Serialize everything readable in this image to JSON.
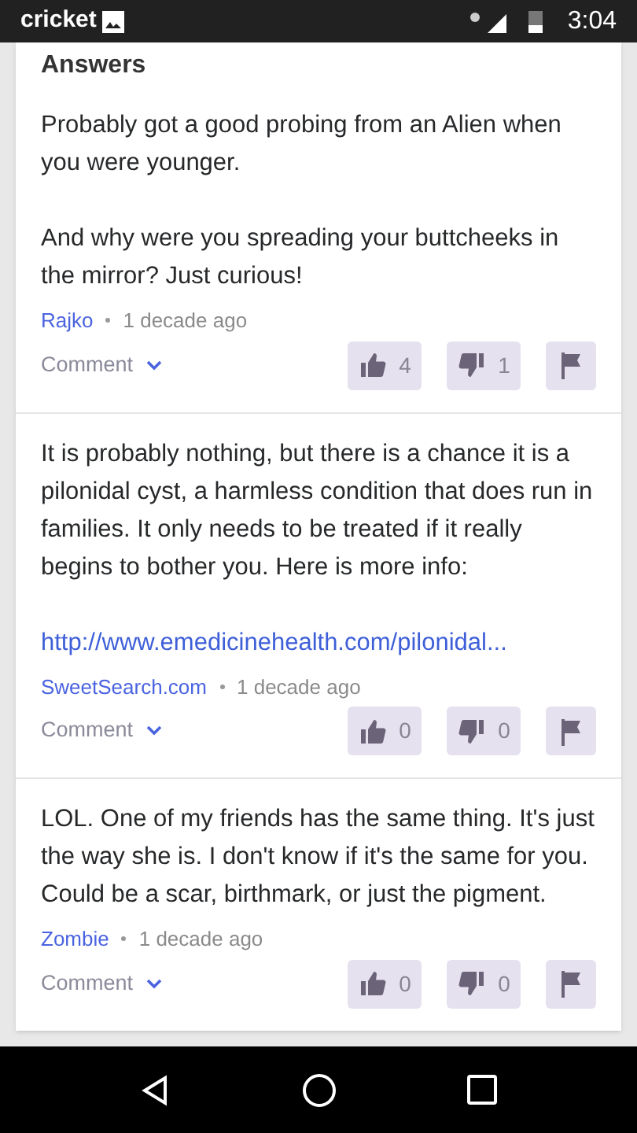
{
  "status_bar": {
    "carrier": "cricket",
    "time": "3:04"
  },
  "section_title": "Answers",
  "answers": [
    {
      "paragraphs": [
        "Probably got a good probing from an Alien when you were younger.",
        "And why were you spreading your buttcheeks in the mirror? Just curious!"
      ],
      "author": "Rajko",
      "time": "1 decade ago",
      "comment_label": "Comment",
      "upvotes": "4",
      "downvotes": "1"
    },
    {
      "paragraphs": [
        "It is probably nothing, but there is a chance it is a pilonidal cyst, a harmless condition that does run in families. It only needs to be treated if it really begins to bother you. Here is more info:"
      ],
      "link": "http://www.emedicinehealth.com/pilonidal...",
      "author": "SweetSearch.com",
      "time": "1 decade ago",
      "comment_label": "Comment",
      "upvotes": "0",
      "downvotes": "0"
    },
    {
      "paragraphs": [
        "LOL. One of my friends has the same thing. It's just the way she is. I don't know if it's the same for you. Could be a scar, birthmark, or just the pigment."
      ],
      "author": "Zombie",
      "time": "1 decade ago",
      "comment_label": "Comment",
      "upvotes": "0",
      "downvotes": "0"
    }
  ]
}
